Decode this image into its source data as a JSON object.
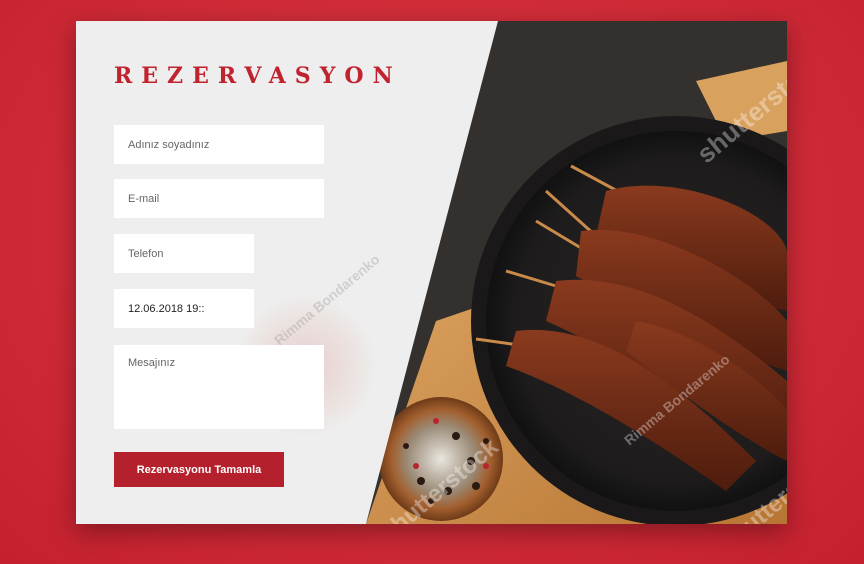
{
  "form": {
    "title": "REZERVASYON",
    "name_placeholder": "Adınız soyadınız",
    "email_placeholder": "E-mail",
    "phone_placeholder": "Telefon",
    "datetime_value": "12.06.2018 19::",
    "message_placeholder": "Mesajınız",
    "submit_label": "Rezervasyonu Tamamla"
  },
  "watermarks": {
    "brand": "shutterstock",
    "author": "Rimma Bondarenko"
  },
  "colors": {
    "background": "#cf2a37",
    "accent": "#b4202b",
    "panel": "#eeeeee"
  }
}
